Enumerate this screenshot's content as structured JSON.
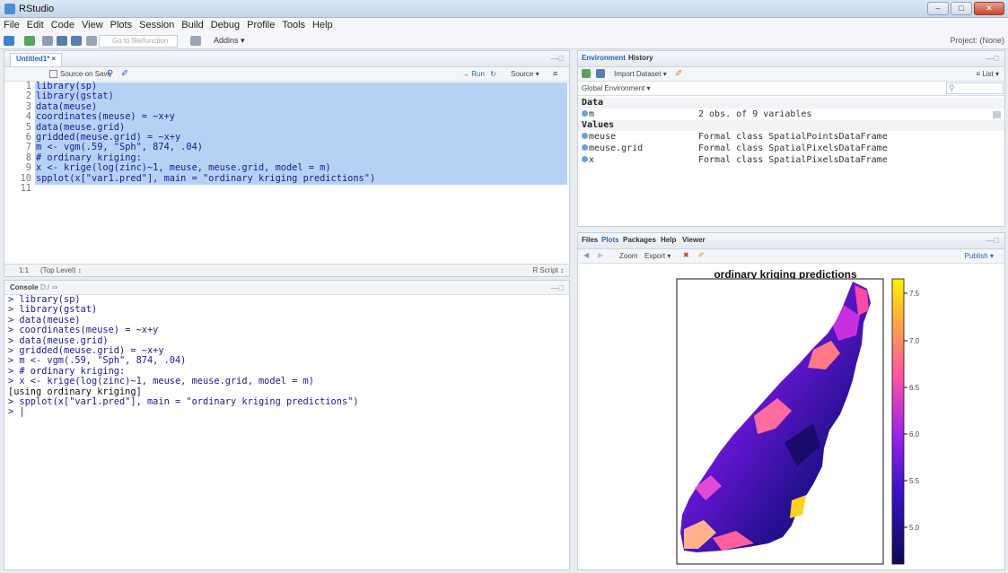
{
  "window": {
    "title": "RStudio",
    "min": "–",
    "max": "□",
    "close": "✕"
  },
  "menu": [
    "File",
    "Edit",
    "Code",
    "View",
    "Plots",
    "Session",
    "Build",
    "Debug",
    "Profile",
    "Tools",
    "Help"
  ],
  "toolbar": {
    "goto_placeholder": "Go to file/function",
    "addins": "Addins ▾",
    "project": "Project: (None)"
  },
  "editor": {
    "tab": "Untitled1* ×",
    "source_on_save": "Source on Save",
    "run": "→ Run",
    "source": "Source ▾",
    "lines": [
      {
        "n": "1",
        "code": "library(sp)"
      },
      {
        "n": "2",
        "code": "library(gstat)"
      },
      {
        "n": "3",
        "code": "data(meuse)"
      },
      {
        "n": "4",
        "code": "coordinates(meuse) = ~x+y"
      },
      {
        "n": "5",
        "code": "data(meuse.grid)"
      },
      {
        "n": "6",
        "code": "gridded(meuse.grid) = ~x+y"
      },
      {
        "n": "7",
        "code": "m <- vgm(.59, \"Sph\", 874, .04)"
      },
      {
        "n": "8",
        "code": "# ordinary kriging:"
      },
      {
        "n": "9",
        "code": "x <- krige(log(zinc)~1, meuse, meuse.grid, model = m)"
      },
      {
        "n": "10",
        "code": "spplot(x[\"var1.pred\"], main = \"ordinary kriging predictions\")"
      },
      {
        "n": "11",
        "code": ""
      }
    ],
    "cursor_pos": "1:1",
    "scope": "(Top Level) ↕",
    "file_type": "R Script ↕"
  },
  "console": {
    "title": "Console",
    "path": "D:/ ⇒",
    "lines": [
      "> library(sp)",
      "> library(gstat)",
      "> data(meuse)",
      "> coordinates(meuse) = ~x+y",
      "> data(meuse.grid)",
      "> gridded(meuse.grid) = ~x+y",
      "> m <- vgm(.59, \"Sph\", 874, .04)",
      "> # ordinary kriging:",
      "> x <- krige(log(zinc)~1, meuse, meuse.grid, model = m)",
      "[using ordinary kriging]",
      "> spplot(x[\"var1.pred\"], main = \"ordinary kriging predictions\")",
      "> |"
    ]
  },
  "environment": {
    "tabs": [
      "Environment",
      "History"
    ],
    "import": "Import Dataset ▾",
    "list": "≡ List ▾",
    "scope": "Global Environment ▾",
    "data_header": "Data",
    "data_rows": [
      {
        "name": "m",
        "value": "2 obs. of 9 variables"
      }
    ],
    "values_header": "Values",
    "value_rows": [
      {
        "name": "meuse",
        "value": "Formal class SpatialPointsDataFrame"
      },
      {
        "name": "meuse.grid",
        "value": "Formal class SpatialPixelsDataFrame"
      },
      {
        "name": "x",
        "value": "Formal class SpatialPixelsDataFrame"
      }
    ]
  },
  "files": {
    "tabs": [
      "Files",
      "Plots",
      "Packages",
      "Help",
      "Viewer"
    ],
    "zoom": "Zoom",
    "export": "Export ▾",
    "publish": "Publish ▾"
  },
  "plot": {
    "title": "ordinary kriging predictions",
    "ticks": [
      "7.5",
      "7.0",
      "6.5",
      "6.0",
      "5.5",
      "5.0"
    ]
  },
  "colors": {
    "selection": "#b5d2f5",
    "code": "#1e1a8f",
    "comment": "#3a7d3a"
  }
}
